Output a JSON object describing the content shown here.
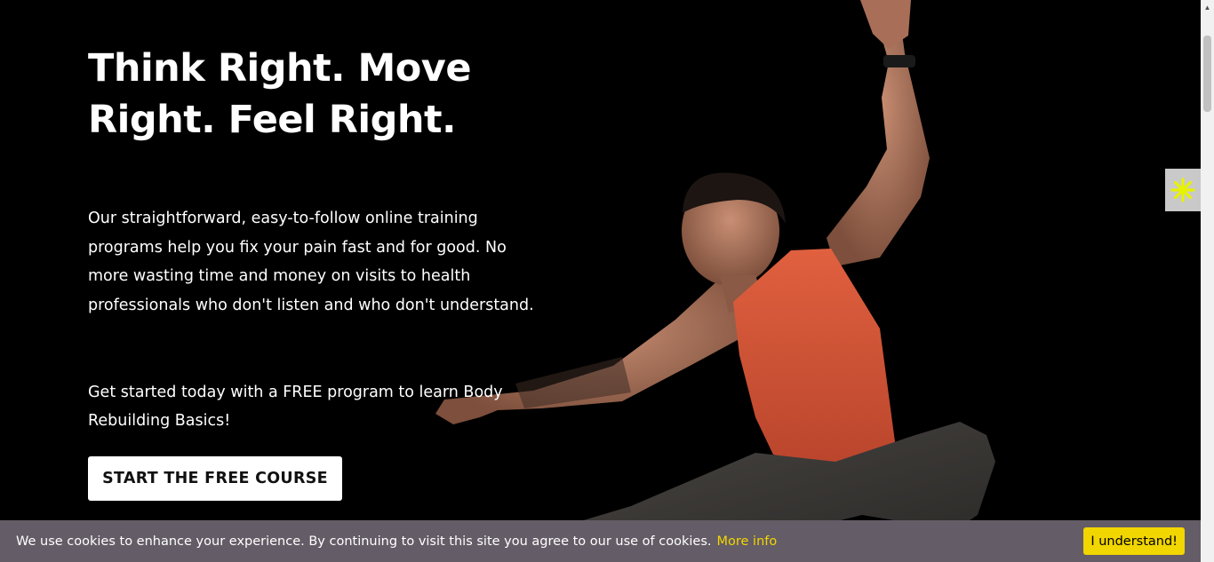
{
  "hero": {
    "headline": "Think Right. Move Right. Feel Right.",
    "intro": "Our straightforward, easy-to-follow online training programs help you fix your pain fast and for good. No more wasting time and money on visits to health professionals who don't listen and who don't understand.",
    "cta_text": "Get started today with a FREE program to learn Body Rebuilding Basics!",
    "cta_button": "START THE FREE COURSE"
  },
  "side_widget": {
    "icon": "asterisk-icon",
    "color": "#e7f300"
  },
  "cookie_bar": {
    "message": "We use cookies to enhance your experience. By continuing to visit this site you agree to our use of cookies.",
    "more_info": "More info",
    "accept": "I understand!"
  },
  "colors": {
    "background": "#000000",
    "cookie_bar": "#645c66",
    "accent": "#f1d600",
    "shirt": "#d4573a"
  }
}
